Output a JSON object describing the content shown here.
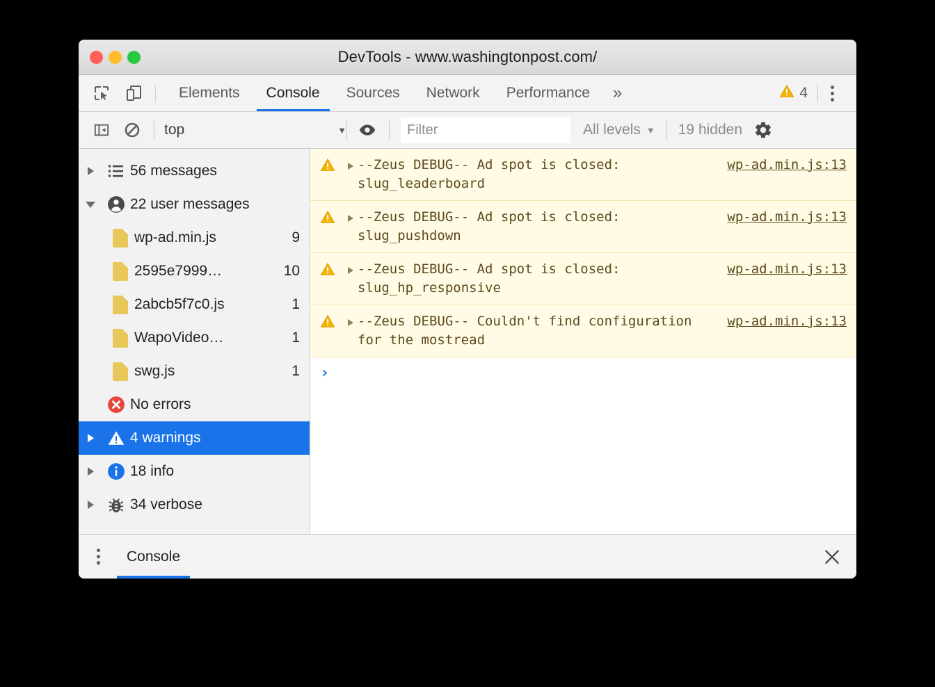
{
  "window": {
    "title": "DevTools - www.washingtonpost.com/",
    "traffic_lights": [
      "close",
      "minimize",
      "zoom"
    ]
  },
  "tabbar": {
    "inspect_icon": "inspect-element-icon",
    "device_icon": "device-toolbar-icon",
    "tabs": [
      {
        "label": "Elements",
        "active": false
      },
      {
        "label": "Console",
        "active": true
      },
      {
        "label": "Sources",
        "active": false
      },
      {
        "label": "Network",
        "active": false
      },
      {
        "label": "Performance",
        "active": false
      }
    ],
    "more_tabs_label": "»",
    "warning_badge": {
      "icon": "warning-triangle-icon",
      "count": "4"
    },
    "menu_icon": "kebab-menu-icon"
  },
  "filterbar": {
    "sidebar_toggle_icon": "console-sidebar-toggle-icon",
    "clear_icon": "clear-console-icon",
    "context": {
      "value": "top",
      "caret": "▼"
    },
    "eye_icon": "live-expression-eye-icon",
    "filter": {
      "value": "",
      "placeholder": "Filter"
    },
    "levels": {
      "label": "All levels",
      "caret": "▼"
    },
    "hidden": "19 hidden",
    "settings_icon": "settings-gear-icon"
  },
  "sidebar": {
    "items": [
      {
        "label": "56 messages",
        "count": "",
        "icon": "list-icon",
        "arrow": "collapsed",
        "indent": "root",
        "selected": false
      },
      {
        "label": "22 user messages",
        "count": "",
        "icon": "user-icon",
        "arrow": "expanded",
        "indent": "root",
        "selected": false
      },
      {
        "label": "wp-ad.min.js",
        "count": "9",
        "icon": "file-icon",
        "arrow": "none",
        "indent": "child",
        "selected": false
      },
      {
        "label": "2595e7999…",
        "count": "10",
        "icon": "file-icon",
        "arrow": "none",
        "indent": "child",
        "selected": false
      },
      {
        "label": "2abcb5f7c0.js",
        "count": "1",
        "icon": "file-icon",
        "arrow": "none",
        "indent": "child",
        "selected": false
      },
      {
        "label": "WapoVideo…",
        "count": "1",
        "icon": "file-icon",
        "arrow": "none",
        "indent": "child",
        "selected": false
      },
      {
        "label": "swg.js",
        "count": "1",
        "icon": "file-icon",
        "arrow": "none",
        "indent": "child",
        "selected": false
      },
      {
        "label": "No errors",
        "count": "",
        "icon": "error-circle-icon",
        "arrow": "none",
        "indent": "noarrow",
        "selected": false
      },
      {
        "label": "4 warnings",
        "count": "",
        "icon": "warning-triangle-icon",
        "arrow": "collapsed",
        "indent": "root",
        "selected": true
      },
      {
        "label": "18 info",
        "count": "",
        "icon": "info-circle-icon",
        "arrow": "collapsed",
        "indent": "root",
        "selected": false
      },
      {
        "label": "34 verbose",
        "count": "",
        "icon": "bug-icon",
        "arrow": "collapsed",
        "indent": "root",
        "selected": false
      }
    ]
  },
  "console": {
    "messages": [
      {
        "level": "warning",
        "text": "--Zeus DEBUG-- Ad spot is closed: slug_leaderboard",
        "source": "wp-ad.min.js:13"
      },
      {
        "level": "warning",
        "text": "--Zeus DEBUG-- Ad spot is closed: slug_pushdown",
        "source": "wp-ad.min.js:13"
      },
      {
        "level": "warning",
        "text": "--Zeus DEBUG-- Ad spot is closed: slug_hp_responsive",
        "source": "wp-ad.min.js:13"
      },
      {
        "level": "warning",
        "text": "--Zeus DEBUG-- Couldn't find configuration for the mostread",
        "source": "wp-ad.min.js:13"
      }
    ],
    "prompt_symbol": "›"
  },
  "drawer": {
    "menu_icon": "drawer-kebab-icon",
    "tabs": [
      {
        "label": "Console",
        "active": true
      }
    ],
    "close_icon": "close-icon"
  },
  "colors": {
    "accent_blue": "#1a73e8",
    "warning_yellow": "#f0b400",
    "warning_row_bg": "#fffbe5",
    "warning_text": "#5c4a1e",
    "error_red": "#e8453c",
    "info_blue": "#1a73e8",
    "file_icon_gold": "#e8c85a"
  }
}
